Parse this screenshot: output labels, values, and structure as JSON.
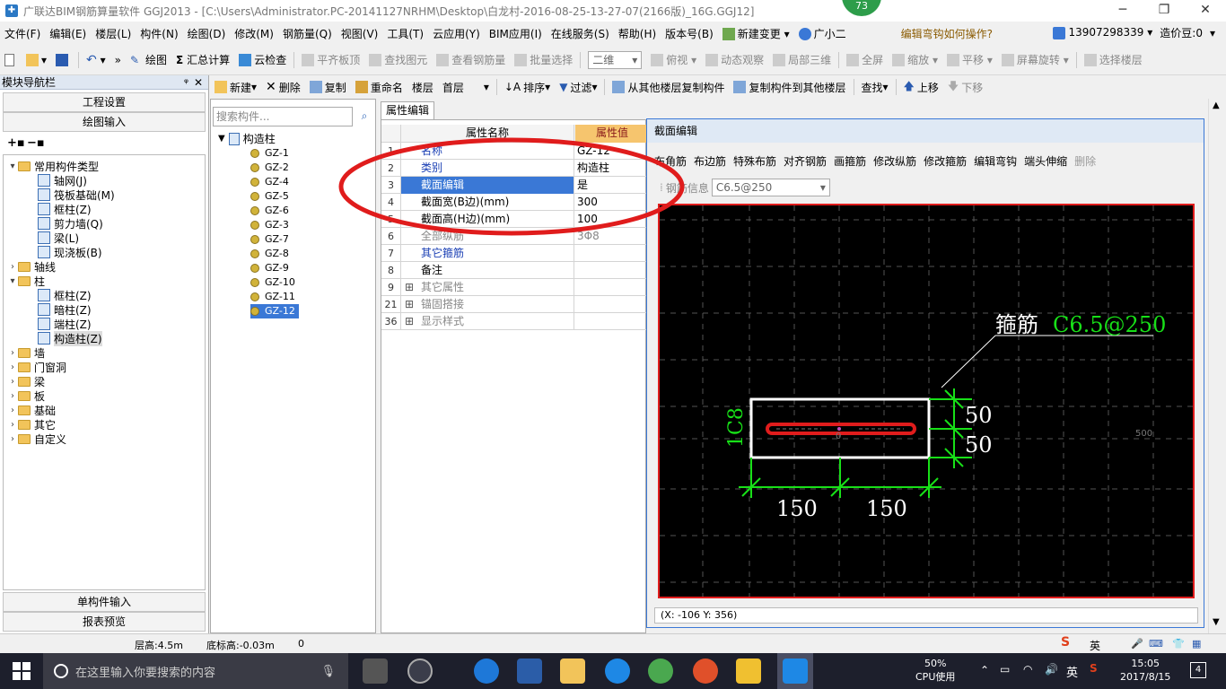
{
  "titlebar": {
    "title": "广联达BIM钢筋算量软件 GGJ2013 - [C:\\Users\\Administrator.PC-20141127NRHM\\Desktop\\白龙村-2016-08-25-13-27-07(2166版)_16G.GGJ12]",
    "badge": "73"
  },
  "menu": {
    "items": [
      "文件(F)",
      "编辑(E)",
      "楼层(L)",
      "构件(N)",
      "绘图(D)",
      "修改(M)",
      "钢筋量(Q)",
      "视图(V)",
      "工具(T)",
      "云应用(Y)",
      "BIM应用(I)",
      "在线服务(S)",
      "帮助(H)",
      "版本号(B)",
      "新建变更",
      "广小二"
    ],
    "hint": "编辑弯钩如何操作?",
    "account": "13907298339",
    "price": "造价豆:0"
  },
  "toolbar1": {
    "draw": "绘图",
    "sum": "汇总计算",
    "cloudcheck": "云检查",
    "flat": "平齐板顶",
    "find": "查找图元",
    "viewrebar": "查看钢筋量",
    "batch": "批量选择",
    "view2d": "二维",
    "top": "俯视",
    "dynamic": "动态观察",
    "local3d": "局部三维",
    "fullscreen": "全屏",
    "zoom": "缩放",
    "pan": "平移",
    "rotate": "屏幕旋转",
    "selectfloor": "选择楼层"
  },
  "toolbar2": {
    "new": "新建",
    "delete": "删除",
    "copy": "复制",
    "rename": "重命名",
    "floor_label": "楼层",
    "floor_value": "首层",
    "sort": "排序",
    "filter": "过滤",
    "copy_from": "从其他楼层复制构件",
    "copy_to": "复制构件到其他楼层",
    "findbtn": "查找",
    "up": "上移",
    "down": "下移"
  },
  "leftpanel": {
    "header": "模块导航栏",
    "btn_project": "工程设置",
    "btn_draw": "绘图输入",
    "btn_single": "单构件输入",
    "btn_report": "报表预览",
    "tree": [
      {
        "label": "常用构件类型",
        "level": 0,
        "folder": true,
        "open": true
      },
      {
        "label": "轴网(J)",
        "level": 1
      },
      {
        "label": "筏板基础(M)",
        "level": 1
      },
      {
        "label": "框柱(Z)",
        "level": 1
      },
      {
        "label": "剪力墙(Q)",
        "level": 1
      },
      {
        "label": "梁(L)",
        "level": 1
      },
      {
        "label": "现浇板(B)",
        "level": 1
      },
      {
        "label": "轴线",
        "level": 0,
        "folder": true
      },
      {
        "label": "柱",
        "level": 0,
        "folder": true,
        "open": true
      },
      {
        "label": "框柱(Z)",
        "level": 1
      },
      {
        "label": "暗柱(Z)",
        "level": 1
      },
      {
        "label": "端柱(Z)",
        "level": 1
      },
      {
        "label": "构造柱(Z)",
        "level": 1,
        "selected": true
      },
      {
        "label": "墙",
        "level": 0,
        "folder": true
      },
      {
        "label": "门窗洞",
        "level": 0,
        "folder": true
      },
      {
        "label": "梁",
        "level": 0,
        "folder": true
      },
      {
        "label": "板",
        "level": 0,
        "folder": true
      },
      {
        "label": "基础",
        "level": 0,
        "folder": true
      },
      {
        "label": "其它",
        "level": 0,
        "folder": true
      },
      {
        "label": "自定义",
        "level": 0,
        "folder": true
      }
    ]
  },
  "midpanel": {
    "search_placeholder": "搜索构件...",
    "root": "构造柱",
    "items": [
      "GZ-1",
      "GZ-2",
      "GZ-4",
      "GZ-5",
      "GZ-6",
      "GZ-3",
      "GZ-7",
      "GZ-8",
      "GZ-9",
      "GZ-10",
      "GZ-11",
      "GZ-12"
    ],
    "active": "GZ-12"
  },
  "props": {
    "tab": "属性编辑",
    "col_name": "属性名称",
    "col_value": "属性值",
    "rows": [
      {
        "num": "1",
        "name": "名称",
        "value": "GZ-12",
        "style": "blue"
      },
      {
        "num": "2",
        "name": "类别",
        "value": "构造柱",
        "style": "blue"
      },
      {
        "num": "3",
        "name": "截面编辑",
        "value": "是",
        "style": "hl"
      },
      {
        "num": "4",
        "name": "截面宽(B边)(mm)",
        "value": "300",
        "style": ""
      },
      {
        "num": "5",
        "name": "截面高(H边)(mm)",
        "value": "100",
        "style": ""
      },
      {
        "num": "6",
        "name": "全部纵筋",
        "value": "3Φ8",
        "style": "gray"
      },
      {
        "num": "7",
        "name": "其它箍筋",
        "value": "",
        "style": "blue"
      },
      {
        "num": "8",
        "name": "备注",
        "value": "",
        "style": ""
      },
      {
        "num": "9",
        "name": "其它属性",
        "value": "",
        "style": "gray",
        "expand": true
      },
      {
        "num": "21",
        "name": "锚固搭接",
        "value": "",
        "style": "gray",
        "expand": true
      },
      {
        "num": "36",
        "name": "显示样式",
        "value": "",
        "style": "gray",
        "expand": true
      }
    ]
  },
  "section": {
    "title": "截面编辑",
    "tools": [
      "布角筋",
      "布边筋",
      "特殊布筋",
      "对齐钢筋",
      "画箍筋",
      "修改纵筋",
      "修改箍筋",
      "编辑弯钩",
      "端头伸缩",
      "删除"
    ],
    "rebar_label": "钢筋信息",
    "rebar_value": "C6.5@250",
    "stirrup_label": "箍筋",
    "stirrup_value": "C6.5@250",
    "rebar_left": "1C8",
    "dim_right_top": "50",
    "dim_right_bottom": "50",
    "dim_bottom_left": "150",
    "dim_bottom_right": "150",
    "center_mark": "0",
    "axis_label": "500",
    "coords": "(X: -106 Y: 356)"
  },
  "statusbar": {
    "floor_height": "层高:4.5m",
    "base_height": "底标高:-0.03m",
    "zero": "0"
  },
  "taskbar": {
    "search_placeholder": "在这里输入你要搜索的内容",
    "cpu_percent": "50%",
    "cpu_label": "CPU使用",
    "ime": "英",
    "time": "15:05",
    "date": "2017/8/15",
    "notif": "4"
  },
  "colors": {
    "accent": "#3a78d6",
    "annotation_red": "#e01c1c",
    "rebar_green": "#18e018",
    "canvas_bg": "#000000"
  }
}
